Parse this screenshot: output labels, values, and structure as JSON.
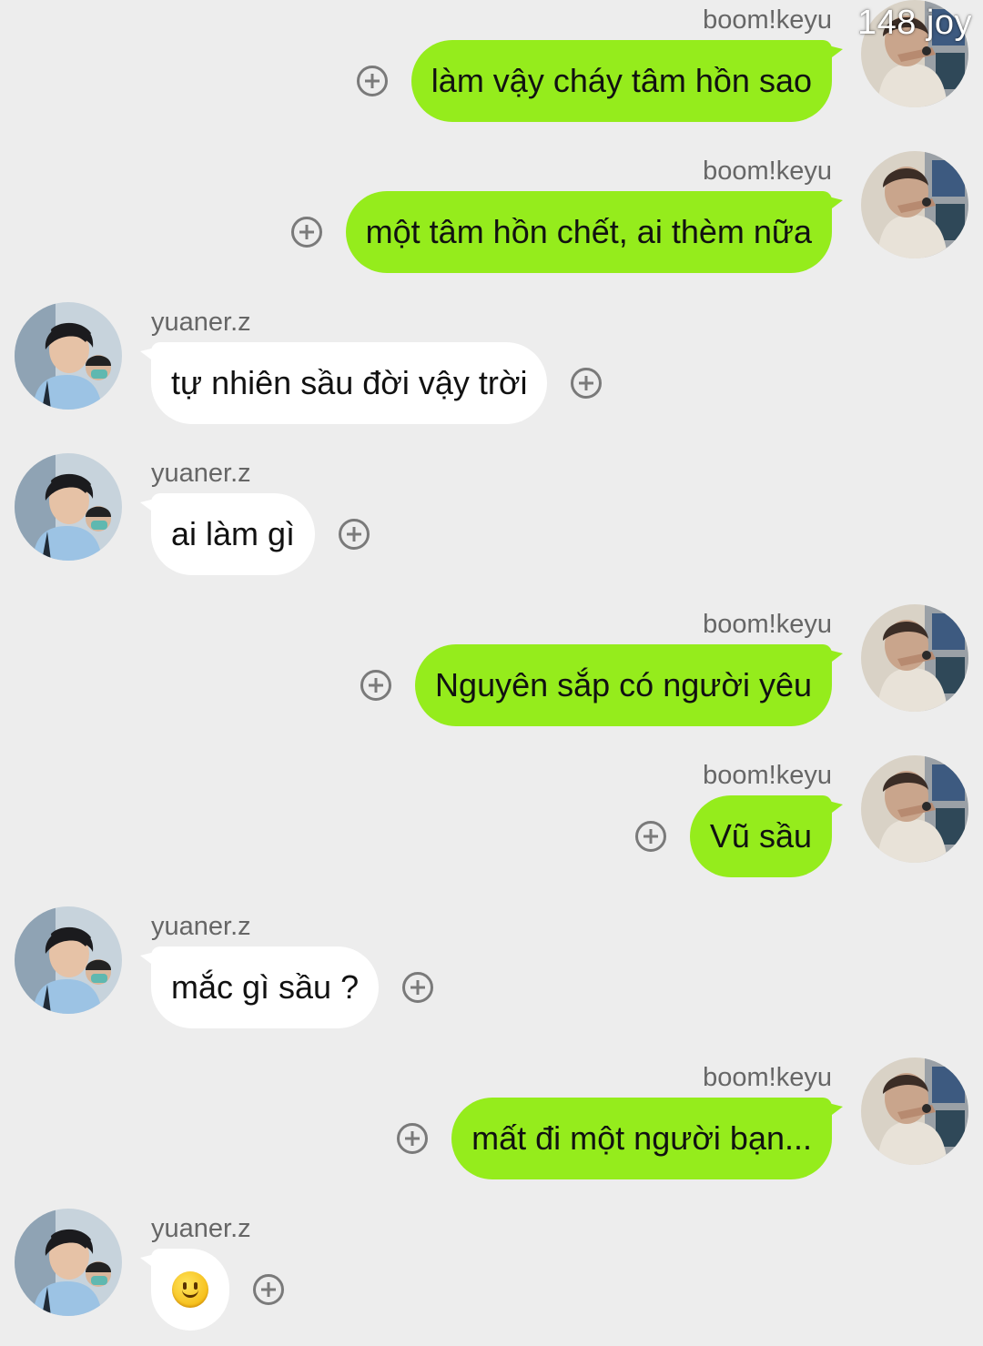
{
  "watermark": "148 joy",
  "contacts": {
    "me": {
      "name": "boom!keyu",
      "avatar_icon": "avatar-photo-boomkeyu"
    },
    "them": {
      "name": "yuaner.z",
      "avatar_icon": "avatar-photo-yuanerz"
    }
  },
  "colors": {
    "background": "#ededed",
    "sent_bubble": "#95ec1c",
    "received_bubble": "#ffffff"
  },
  "messages": [
    {
      "direction": "sent",
      "sender": "boom!keyu",
      "text": "làm vậy cháy tâm hồn sao"
    },
    {
      "direction": "sent",
      "sender": "boom!keyu",
      "text": "một tâm hồn chết, ai thèm nữa"
    },
    {
      "direction": "received",
      "sender": "yuaner.z",
      "text": "tự nhiên sầu đời vậy trời"
    },
    {
      "direction": "received",
      "sender": "yuaner.z",
      "text": "ai làm gì"
    },
    {
      "direction": "sent",
      "sender": "boom!keyu",
      "text": "Nguyên sắp có người yêu"
    },
    {
      "direction": "sent",
      "sender": "boom!keyu",
      "text": "Vũ sầu"
    },
    {
      "direction": "received",
      "sender": "yuaner.z",
      "text": "mắc gì sầu ?"
    },
    {
      "direction": "sent",
      "sender": "boom!keyu",
      "text": "mất đi một người bạn..."
    },
    {
      "direction": "received",
      "sender": "yuaner.z",
      "emoji": "smiley-face-icon"
    }
  ]
}
